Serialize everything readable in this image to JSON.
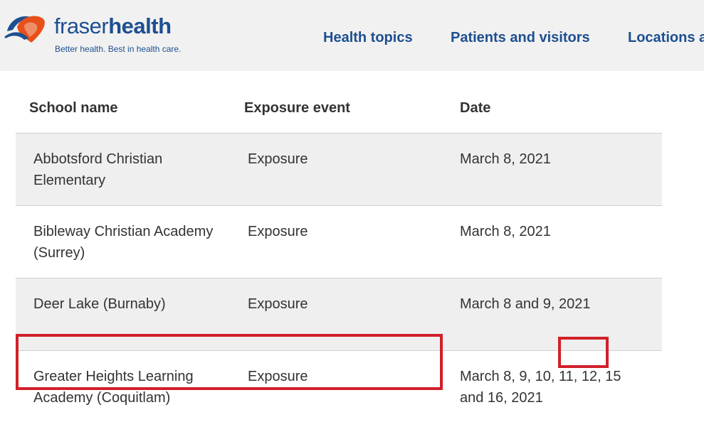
{
  "header": {
    "logo": {
      "name_light": "fraser",
      "name_bold": "health",
      "tagline": "Better health. Best in health care."
    },
    "nav": [
      {
        "label": "Health topics"
      },
      {
        "label": "Patients and visitors"
      },
      {
        "label": "Locations a"
      }
    ],
    "colors": {
      "brand": "#1d4f91",
      "logo_orange": "#e8501a",
      "header_bg": "#f1f1f1"
    }
  },
  "table": {
    "columns": [
      "School name",
      "Exposure event",
      "Date"
    ],
    "rows": [
      {
        "school": "Abbotsford Christian Elementary",
        "event": "Exposure",
        "date": "March 8, 2021"
      },
      {
        "school": "Bibleway Christian Academy (Surrey)",
        "event": "Exposure",
        "date": "March 8, 2021"
      },
      {
        "school": "Deer Lake (Burnaby)",
        "event": "Exposure",
        "date": "March 8 and 9, 2021"
      },
      {
        "school": "Greater Heights Learning Academy (Coquitlam)",
        "event": "Exposure",
        "date": "March 8, 9, 10, 11, 12, 15 and 16, 2021"
      }
    ],
    "colors": {
      "row_shade": "#efefef",
      "highlight": "#d0202a"
    }
  }
}
